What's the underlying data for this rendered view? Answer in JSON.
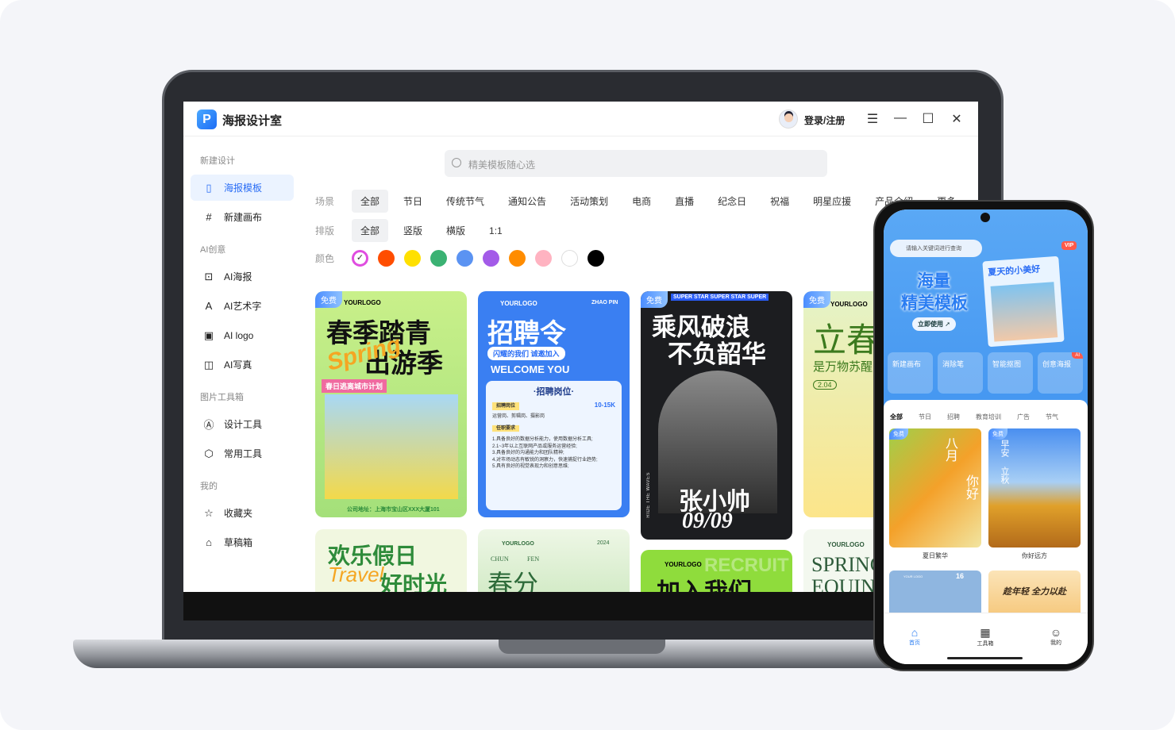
{
  "app": {
    "title": "海报设计室",
    "logo_letter": "P",
    "login": "登录/注册",
    "menu_icon": "menu-icon",
    "minimize_icon": "minimize-icon",
    "maximize_icon": "maximize-icon",
    "close_icon": "close-icon"
  },
  "sidebar": {
    "sections": [
      {
        "title": "新建设计",
        "items": [
          {
            "label": "海报模板",
            "icon": "poster-icon",
            "active": true
          },
          {
            "label": "新建画布",
            "icon": "canvas-grid-icon"
          }
        ]
      },
      {
        "title": "AI创意",
        "items": [
          {
            "label": "AI海报",
            "icon": "ai-poster-icon"
          },
          {
            "label": "AI艺术字",
            "icon": "ai-font-icon"
          },
          {
            "label": "AI logo",
            "icon": "logo-icon"
          },
          {
            "label": "AI写真",
            "icon": "ai-photo-icon"
          }
        ]
      },
      {
        "title": "图片工具箱",
        "items": [
          {
            "label": "设计工具",
            "icon": "design-tool-icon"
          },
          {
            "label": "常用工具",
            "icon": "cube-icon"
          }
        ]
      },
      {
        "title": "我的",
        "items": [
          {
            "label": "收藏夹",
            "icon": "favorites-icon"
          },
          {
            "label": "草稿箱",
            "icon": "drafts-icon"
          }
        ]
      }
    ]
  },
  "search": {
    "placeholder": "精美模板随心选"
  },
  "filters": {
    "scene": {
      "label": "场景",
      "options": [
        "全部",
        "节日",
        "传统节气",
        "通知公告",
        "活动策划",
        "电商",
        "直播",
        "纪念日",
        "祝福",
        "明星应援",
        "产品介绍",
        "更多"
      ],
      "selected": "全部"
    },
    "layout": {
      "label": "排版",
      "options": [
        "全部",
        "竖版",
        "横版",
        "1:1"
      ],
      "selected": "全部"
    },
    "color": {
      "label": "颜色",
      "options": [
        "#ff4d00",
        "#ffe000",
        "#3bb273",
        "#5b93f2",
        "#a35be8",
        "#ff8c00",
        "#ffb3c1",
        "#ffffff",
        "#000000"
      ],
      "selected": "all"
    }
  },
  "templates": {
    "free_badge": "免费",
    "cards": [
      {
        "title1": "春季踏青",
        "title2": "出游季",
        "script": "Spring",
        "logo": "YOURLOGO",
        "tag": "春日逃离城市计划",
        "footer": "公司地址：上海市宝山区XXX大厦101",
        "free": true
      },
      {
        "logo": "YOURLOGO",
        "corner": "ZHAO PIN",
        "title": "招聘令",
        "sub": "闪耀的我们 诚邀加入",
        "welcome": "WELCOME YOU",
        "section": "·招聘岗位·",
        "job_tag": "招聘岗位",
        "salary": "10-15K",
        "jobs": "运营岗、剪辑岗、摄影岗",
        "req_tag": "任职要求",
        "reqs": [
          "1.具备良好的数据分析能力，使用数据分析工具;",
          "2.1~3年以上互联网产品或服务运营经验;",
          "3.具备良好的沟通能力和团队精神;",
          "4.对市场动态有敏锐的洞察力，快速捕捉行业趋势;",
          "5.具有良好的视觉表现力和创意思维;"
        ],
        "free": false
      },
      {
        "marquee": "SUPER STAR SUPER STAR SUPER",
        "title1": "乘风破浪",
        "title2": "不负韶华",
        "name": "张小帅",
        "date": "09/09",
        "side": "RIDE THE WAVES",
        "free": true
      },
      {
        "logo": "YOURLOGO",
        "title": "立春",
        "sub": "是万物苏醒",
        "date": "2.04",
        "free": true
      },
      {
        "title1": "欢乐假日",
        "script": "Travel",
        "title2": "好时光"
      },
      {
        "logo": "YOURLOGO",
        "year": "2024",
        "pinyin1": "CHUN",
        "pinyin2": "FEN",
        "title": "春分"
      },
      {
        "logo": "YOURLOGO",
        "bg": "RECRUIT",
        "title": "加入我们"
      },
      {
        "logo": "YOURLOGO",
        "title1": "SPRING",
        "title2": "EQUINOX"
      }
    ]
  },
  "phone": {
    "search_placeholder": "请输入关键词进行查询",
    "vip": "VIP",
    "banner": {
      "line1": "海量",
      "line2": "精美模板",
      "cta": "立即使用 ➚",
      "poster": "夏天的小美好"
    },
    "tools": [
      {
        "label": "新建画布",
        "icon": "new-canvas-icon"
      },
      {
        "label": "消除笔",
        "icon": "eraser-icon"
      },
      {
        "label": "智能抠图",
        "icon": "cutout-icon"
      },
      {
        "label": "创意海报",
        "icon": "magic-poster-icon",
        "badge": "AI"
      }
    ],
    "tabs": [
      "全部",
      "节日",
      "招聘",
      "教育培训",
      "广告",
      "节气"
    ],
    "active_tab": "全部",
    "cards": [
      {
        "caption": "夏日繁华",
        "text1": "八月",
        "text2": "你好",
        "free": true
      },
      {
        "caption": "你好远方",
        "text1": "早安",
        "text2": "立秋",
        "free": true
      },
      {
        "date": "16",
        "logo": "YOUR LOGO"
      },
      {
        "text1": "趁年轻 全力以赴"
      }
    ],
    "nav": [
      {
        "label": "首页",
        "icon": "home-icon",
        "active": true
      },
      {
        "label": "工具箱",
        "icon": "grid-icon"
      },
      {
        "label": "我的",
        "icon": "profile-icon"
      }
    ]
  }
}
